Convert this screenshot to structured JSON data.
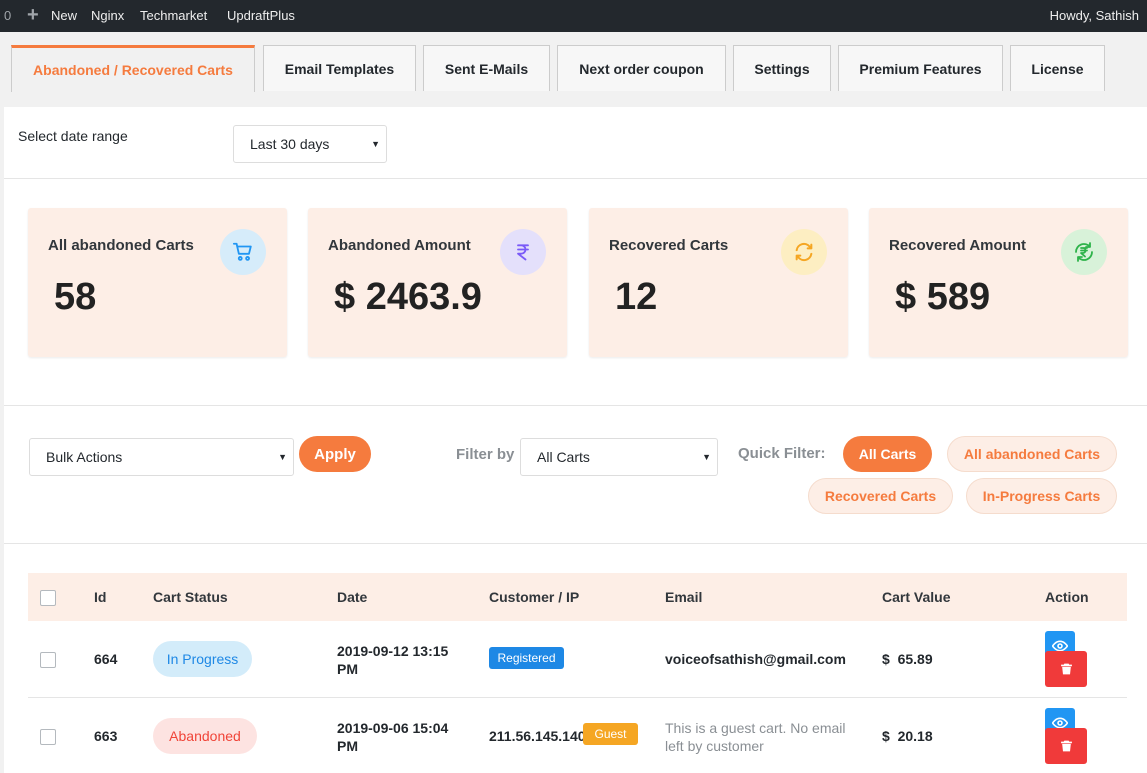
{
  "admin_bar": {
    "counter": "0",
    "new_label": "New",
    "links": [
      "Nginx",
      "Techmarket",
      "UpdraftPlus"
    ],
    "greeting": "Howdy, Sathish"
  },
  "tabs": [
    {
      "label": "Abandoned / Recovered Carts",
      "active": true
    },
    {
      "label": "Email Templates",
      "active": false
    },
    {
      "label": "Sent E-Mails",
      "active": false
    },
    {
      "label": "Next order coupon",
      "active": false
    },
    {
      "label": "Settings",
      "active": false
    },
    {
      "label": "Premium Features",
      "active": false
    },
    {
      "label": "License",
      "active": false
    }
  ],
  "date_range": {
    "label": "Select date range",
    "selected": "Last 30 days"
  },
  "stats": [
    {
      "title": "All abandoned Carts",
      "value": "58",
      "icon": "cart-icon",
      "icon_bg": "#d6ecfa",
      "icon_color": "#2196f3"
    },
    {
      "title": "Abandoned Amount",
      "value": "$ 2463.9",
      "icon": "rupee-icon",
      "icon_bg": "#e4e0fb",
      "icon_color": "#7a5af8"
    },
    {
      "title": "Recovered Carts",
      "value": "12",
      "icon": "refresh-icon",
      "icon_bg": "#fdeec2",
      "icon_color": "#f5a623"
    },
    {
      "title": "Recovered Amount",
      "value": "$ 589",
      "icon": "rupee-recycle-icon",
      "icon_bg": "#d8f2d9",
      "icon_color": "#2eb34a"
    }
  ],
  "toolbar": {
    "bulk_actions": "Bulk Actions",
    "apply": "Apply",
    "filter_by_label": "Filter by",
    "filter_selected": "All Carts",
    "quick_filter_label": "Quick Filter:",
    "quick_filters": [
      {
        "label": "All Carts",
        "active": true
      },
      {
        "label": "All abandoned Carts",
        "active": false
      },
      {
        "label": "Recovered Carts",
        "active": false
      },
      {
        "label": "In-Progress Carts",
        "active": false
      }
    ]
  },
  "table": {
    "columns": [
      "Id",
      "Cart Status",
      "Date",
      "Customer / IP",
      "Email",
      "Cart Value",
      "Action"
    ],
    "rows": [
      {
        "id": "664",
        "status": "In Progress",
        "date_line1": "2019-09-12 13:15",
        "date_line2": "PM",
        "customer": "",
        "customer_badge": "Registered",
        "email_line1": "voiceofsathish@gmail.com",
        "email_line2": "",
        "value": "$  65.89"
      },
      {
        "id": "663",
        "status": "Abandoned",
        "date_line1": "2019-09-06 15:04",
        "date_line2": "PM",
        "customer": "211.56.145.140",
        "customer_badge": "Guest",
        "email_line1": "This is a guest cart. No email",
        "email_line2": "left by customer",
        "value": "$  20.18"
      }
    ]
  },
  "colors": {
    "accent": "#f57b3e",
    "card_bg": "#fdeee6",
    "in_progress_bg": "#d3ecfa",
    "in_progress_text": "#1e88e5",
    "abandoned_bg": "#fde3e1",
    "abandoned_text": "#f04438",
    "registered_badge": "#1e88e5",
    "guest_badge": "#f5a623"
  }
}
